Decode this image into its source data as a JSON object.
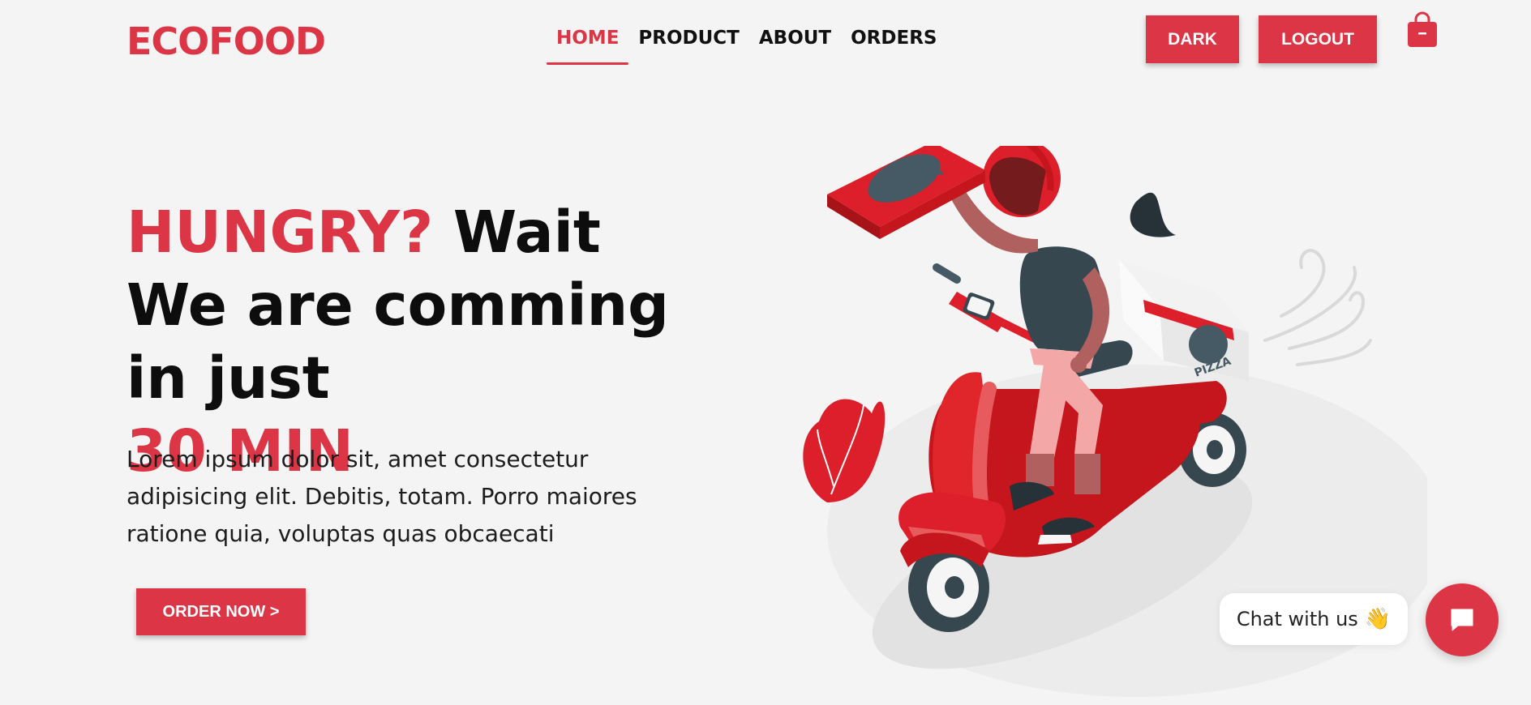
{
  "header": {
    "logo": "ECOFOOD",
    "nav": [
      {
        "label": "HOME",
        "active": true
      },
      {
        "label": "PRODUCT",
        "active": false
      },
      {
        "label": "ABOUT",
        "active": false
      },
      {
        "label": "ORDERS",
        "active": false
      }
    ],
    "dark_label": "DARK",
    "logout_label": "LOGOUT",
    "bag_icon": "shopping-bag-icon"
  },
  "hero": {
    "title_red_1": "HUNGRY?",
    "title_black": " Wait We are comming in just",
    "title_red_2": "30 MIN",
    "description": "Lorem ipsum dolor sit, amet consectetur adipisicing elit. Debitis, totam. Porro maiores ratione quia, voluptas quas obcaecati",
    "order_label": "ORDER NOW >"
  },
  "illustration": {
    "box_text": "PIZZA",
    "delivery_box_text": "PIZZA"
  },
  "chat": {
    "label": "Chat with us",
    "emoji": "👋",
    "button_icon": "chat-icon"
  },
  "colors": {
    "accent": "#dc3545",
    "background": "#f4f4f4"
  }
}
